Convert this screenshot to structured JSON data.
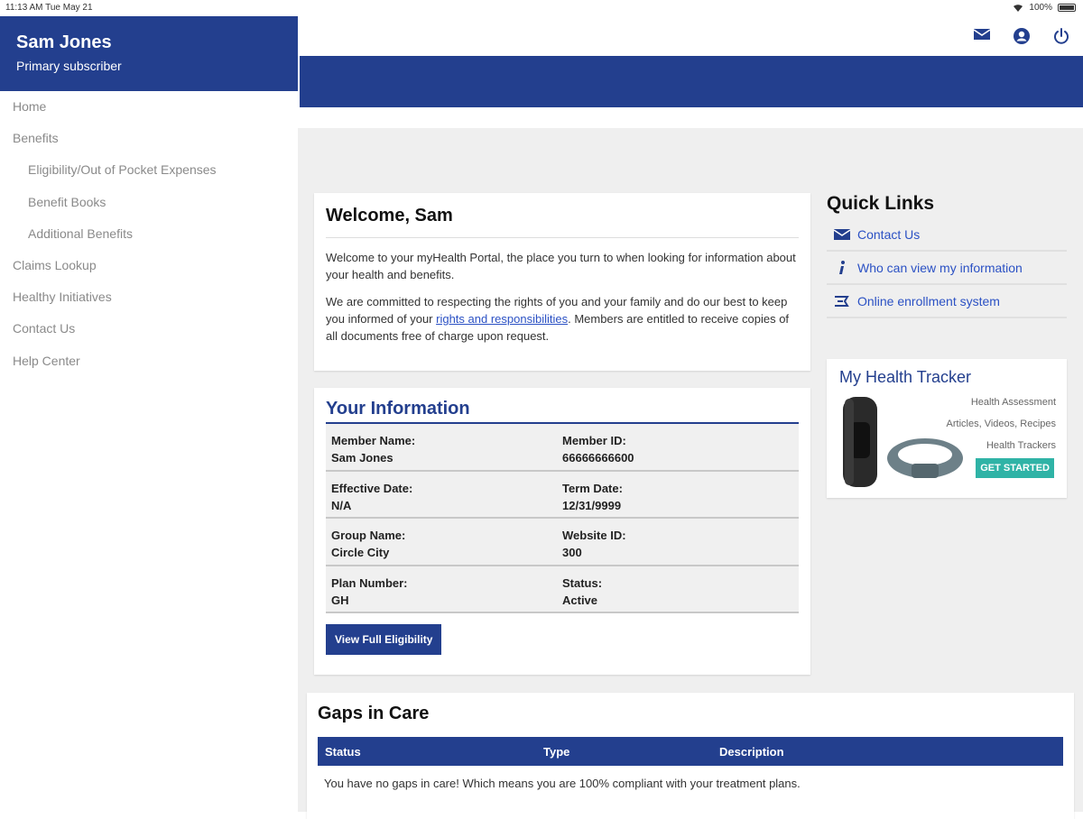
{
  "status_bar": {
    "time": "11:13 AM   Tue May 21",
    "battery": "100%"
  },
  "sidebar": {
    "name": "Sam Jones",
    "role": "Primary subscriber",
    "items": [
      {
        "label": "Home"
      },
      {
        "label": "Benefits"
      },
      {
        "label": "Eligibility/Out of Pocket Expenses"
      },
      {
        "label": "Benefit Books"
      },
      {
        "label": "Additional Benefits"
      },
      {
        "label": "Claims Lookup"
      },
      {
        "label": "Healthy Initiatives"
      },
      {
        "label": "Contact Us"
      },
      {
        "label": "Help Center"
      }
    ]
  },
  "header": {
    "icons": [
      "mail-icon",
      "account-icon",
      "power-icon"
    ]
  },
  "welcome": {
    "title": "Welcome, Sam",
    "p1": "Welcome to your myHealth Portal, the place you turn to when looking for information about your health and benefits.",
    "p2_before": "We are committed to respecting the rights of you and your family and do our best to keep you informed of your ",
    "p2_link": "rights and responsibilities",
    "p2_after": ". Members are entitled to receive copies of all documents free of charge upon request."
  },
  "info": {
    "title": "Your Information",
    "rows": [
      {
        "l_label": "Member Name:",
        "l_value": "Sam Jones",
        "r_label": "Member ID:",
        "r_value": "66666666600"
      },
      {
        "l_label": "Effective Date:",
        "l_value": "N/A",
        "r_label": "Term Date:",
        "r_value": "12/31/9999"
      },
      {
        "l_label": "Group Name:",
        "l_value": "Circle City",
        "r_label": "Website ID:",
        "r_value": "300"
      },
      {
        "l_label": "Plan Number:",
        "l_value": "GH",
        "r_label": "Status:",
        "r_value": "Active"
      }
    ],
    "button": "View Full Eligibility"
  },
  "quick_links": {
    "title": "Quick Links",
    "items": [
      {
        "label": "Contact Us",
        "icon": "envelope-icon"
      },
      {
        "label": "Who can view my information",
        "icon": "info-icon"
      },
      {
        "label": "Online enrollment system",
        "icon": "enrollment-icon"
      }
    ]
  },
  "tracker": {
    "title": "My Health Tracker",
    "lines": [
      "Health Assessment",
      "Articles, Videos, Recipes",
      "Health Trackers"
    ],
    "button": "GET STARTED"
  },
  "gaps": {
    "title": "Gaps in Care",
    "columns": [
      "Status",
      "Type",
      "Description"
    ],
    "message": "You have no gaps in care! Which means you are 100% compliant with your treatment plans."
  },
  "colors": {
    "brand": "#233f8e",
    "link": "#2b51c4",
    "accent": "#2fb3a6"
  }
}
